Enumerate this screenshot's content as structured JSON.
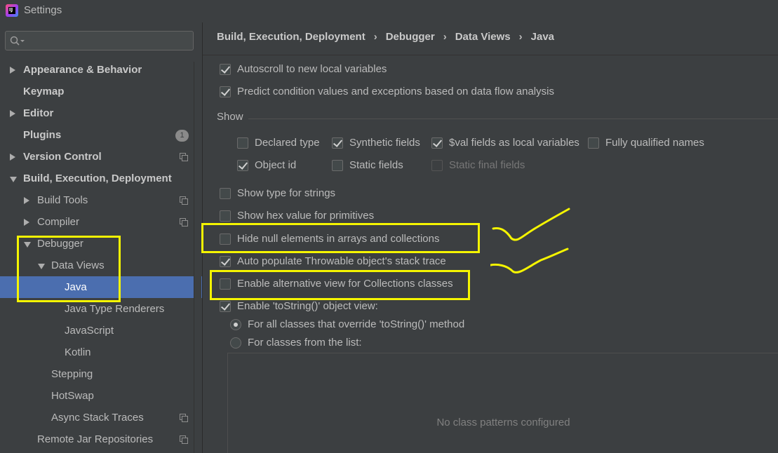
{
  "window": {
    "title": "Settings",
    "app_icon_text": "IJ"
  },
  "sidebar": {
    "search": {
      "value": "",
      "placeholder": ""
    },
    "items": [
      {
        "label": "Appearance & Behavior",
        "expanded": false
      },
      {
        "label": "Keymap"
      },
      {
        "label": "Editor",
        "expanded": false
      },
      {
        "label": "Plugins",
        "badge": "1"
      },
      {
        "label": "Version Control",
        "expanded": false
      },
      {
        "label": "Build, Execution, Deployment",
        "expanded": true
      },
      {
        "label": "Build Tools",
        "expanded": false
      },
      {
        "label": "Compiler",
        "expanded": false
      },
      {
        "label": "Debugger",
        "expanded": true
      },
      {
        "label": "Data Views",
        "expanded": true
      },
      {
        "label": "Java",
        "selected": true
      },
      {
        "label": "Java Type Renderers"
      },
      {
        "label": "JavaScript"
      },
      {
        "label": "Kotlin"
      },
      {
        "label": "Stepping"
      },
      {
        "label": "HotSwap"
      },
      {
        "label": "Async Stack Traces"
      },
      {
        "label": "Remote Jar Repositories"
      }
    ]
  },
  "breadcrumb": [
    "Build, Execution, Deployment",
    "Debugger",
    "Data Views",
    "Java"
  ],
  "options": {
    "autoscroll": {
      "label": "Autoscroll to new local variables",
      "checked": true
    },
    "predict": {
      "label": "Predict condition values and exceptions based on data flow analysis",
      "checked": true
    },
    "show_section": "Show",
    "show": [
      {
        "label": "Declared type",
        "checked": false
      },
      {
        "label": "Synthetic fields",
        "checked": true
      },
      {
        "label": "$val fields as local variables",
        "checked": true
      },
      {
        "label": "Fully qualified names",
        "checked": false
      },
      {
        "label": "Object id",
        "checked": true
      },
      {
        "label": "Static fields",
        "checked": false
      },
      {
        "label": "Static final fields",
        "checked": false,
        "disabled": true
      }
    ],
    "show_type_strings": {
      "label": "Show type for strings",
      "checked": false
    },
    "show_hex": {
      "label": "Show hex value for primitives",
      "checked": false
    },
    "hide_null": {
      "label": "Hide null elements in arrays and collections",
      "checked": false
    },
    "auto_populate": {
      "label": "Auto populate Throwable object's stack trace",
      "checked": true
    },
    "alt_view": {
      "label": "Enable alternative view for Collections classes",
      "checked": false
    },
    "tostring": {
      "label": "Enable 'toString()' object view:",
      "checked": true
    },
    "tostring_all": {
      "label": "For all classes that override 'toString()' method",
      "selected": true
    },
    "tostring_list": {
      "label": "For classes from the list:",
      "selected": false
    },
    "class_list_empty": "No class patterns configured"
  },
  "colors": {
    "highlight": "#f5f500",
    "selection": "#4b6eaf"
  }
}
